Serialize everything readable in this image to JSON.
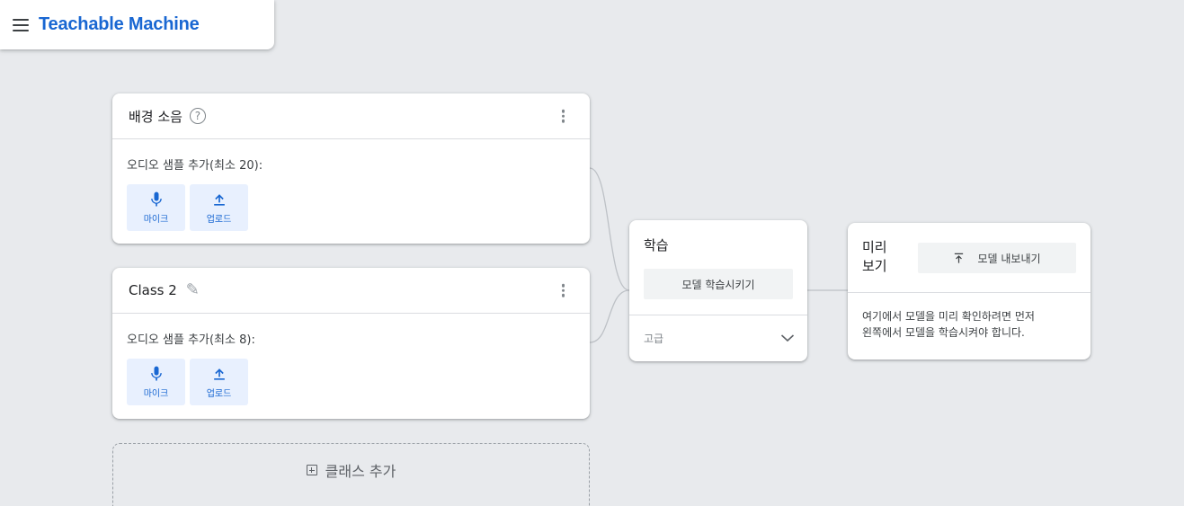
{
  "app": {
    "title": "Teachable Machine",
    "accent_color": "#1967d2",
    "background_color": "#e8eaed",
    "menu_icon": "hamburger-menu-icon"
  },
  "classes": [
    {
      "name": "배경 소음",
      "has_help": true,
      "help_icon": "question-circle-icon",
      "sample_label": "오디오 샘플 추가(최소 20):",
      "mic_label": "마이크",
      "upload_label": "업로드"
    },
    {
      "name": "Class 2",
      "edit_icon": "pencil-icon",
      "sample_label": "오디오 샘플 추가(최소 8):",
      "mic_label": "마이크",
      "upload_label": "업로드"
    }
  ],
  "add_class": {
    "label": "클래스 추가",
    "icon": "plus-box-icon"
  },
  "training": {
    "title": "학습",
    "train_button": "모델 학습시키기",
    "advanced_label": "고급",
    "advanced_icon": "chevron-down-icon"
  },
  "preview": {
    "title": "미리 보기",
    "export_button": "모델 내보내기",
    "export_icon": "export-icon",
    "message_line1": "여기에서 모델을 미리 확인하려면 먼저",
    "message_line2": "왼쪽에서 모델을 학습시켜야 합니다."
  }
}
